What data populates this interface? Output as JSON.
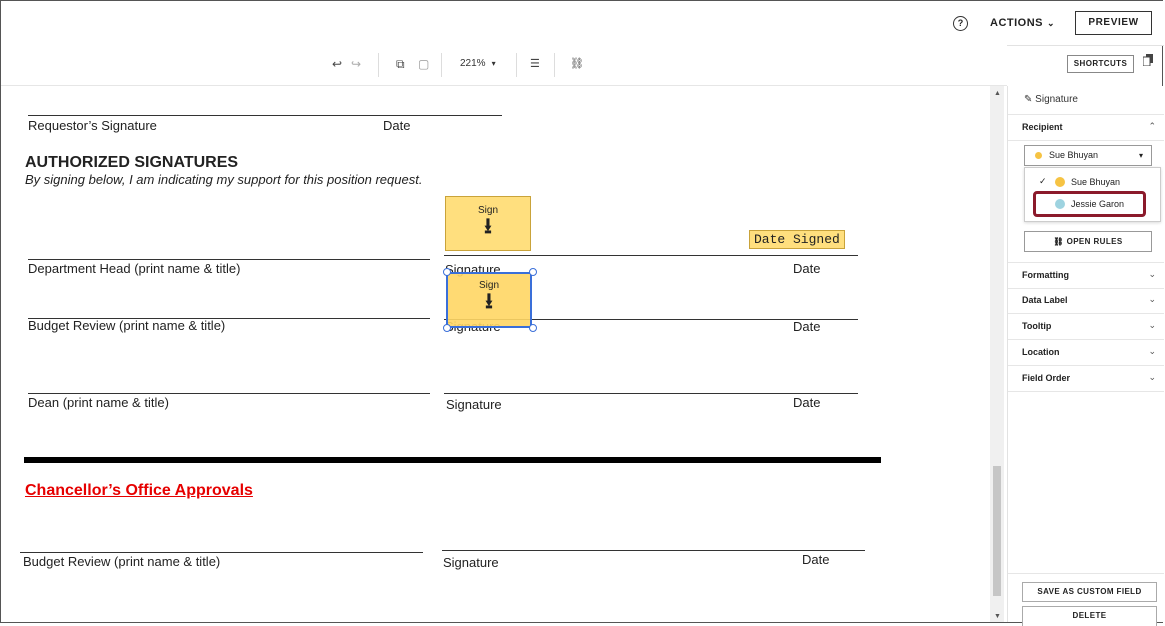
{
  "topbar": {
    "help_icon": "?",
    "actions_label": "ACTIONS",
    "actions_chevron": "⌄",
    "preview_label": "PREVIEW"
  },
  "toolbar": {
    "undo_icon": "↩",
    "redo_icon": "↪",
    "copy_icon": "⧉",
    "paste_icon": "▢",
    "zoom_value": "221%",
    "zoom_caret": "▾",
    "comment_icon": "☰",
    "rules_icon": "⛓",
    "shortcuts_label": "SHORTCUTS"
  },
  "document": {
    "requestor_signature": "Requestor’s Signature",
    "requestor_date": "Date",
    "authorized_heading": "AUTHORIZED SIGNATURES",
    "authorized_subtitle": "By signing below, I am indicating my support for this position request.",
    "sign_label": "Sign",
    "sign_arrow": "⭳",
    "date_signed_label": "Date Signed",
    "dept_head_label": "Department Head (print name & title)",
    "dept_head_signature": "Signature",
    "dept_head_date": "Date",
    "budget_review_label": "Budget Review (print name & title)",
    "budget_review_signature": "Signature",
    "budget_review_date": "Date",
    "dean_label": "Dean (print name & title)",
    "dean_signature": "Signature",
    "dean_date": "Date",
    "chancellor_heading": "Chancellor’s Office Approvals",
    "budget_review2_label": "Budget Review (print name & title)",
    "budget_review2_signature": "Signature",
    "budget_review2_date": "Date"
  },
  "panel": {
    "title_icon": "✎",
    "title": "Signature",
    "recipient_label": "Recipient",
    "recipient_selected": "Sue Bhuyan",
    "recipient_options": [
      {
        "name": "Sue Bhuyan",
        "color": "#f6c343",
        "checked": true
      },
      {
        "name": "Jessie Garon",
        "color": "#9ed3e0",
        "checked": false
      }
    ],
    "open_rules_label": "OPEN RULES",
    "sections": [
      "Formatting",
      "Data Label",
      "Tooltip",
      "Location",
      "Field Order"
    ],
    "save_custom_label": "SAVE AS CUSTOM FIELD",
    "delete_label": "DELETE"
  },
  "colors": {
    "sign_fill": "#ffdf7e",
    "selection_border": "#3a6fd9",
    "chancellor_red": "#e60000",
    "highlight_border": "#8b1a2b"
  }
}
